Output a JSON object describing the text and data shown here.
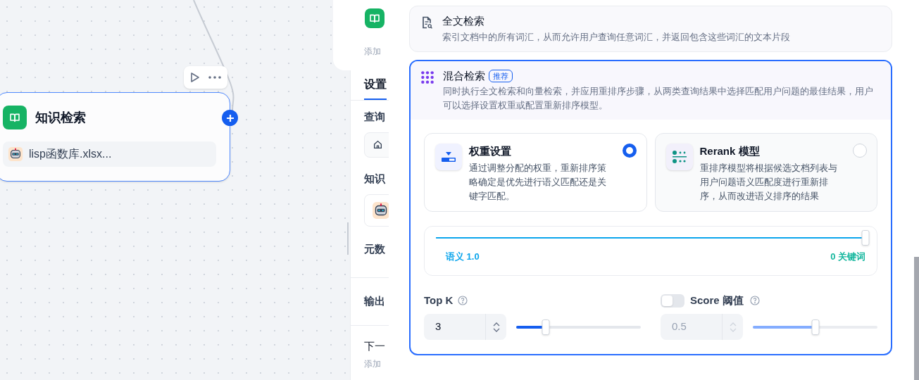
{
  "canvas": {
    "node": {
      "title": "知识检索",
      "items": [
        {
          "label": "lisp函数库.xlsx..."
        }
      ]
    }
  },
  "middle_panel": {
    "hint": "添加",
    "tabs": [
      {
        "label": "设置",
        "selected": true
      }
    ],
    "sections": [
      {
        "label": "查询"
      },
      {
        "label": "知识"
      },
      {
        "label": "元数"
      },
      {
        "label": "输出"
      },
      {
        "label": "下一",
        "hint": "添加"
      }
    ]
  },
  "retrieval_modes": [
    {
      "kind": "fulltext",
      "title": "全文检索",
      "description": "索引文档中的所有词汇，从而允许用户查询任意词汇，并返回包含这些词汇的文本片段",
      "selected": false
    },
    {
      "kind": "hybrid",
      "title": "混合检索",
      "badge": "推荐",
      "description": "同时执行全文检索和向量检索，并应用重排序步骤，从两类查询结果中选择匹配用户问题的最佳结果，用户可以选择设置权重或配置重新排序模型。",
      "selected": true
    }
  ],
  "rerank_options": [
    {
      "kind": "weight",
      "title": "权重设置",
      "description": "通过调整分配的权重，重新排序策略确定是优先进行语义匹配还是关键字匹配。",
      "selected": true
    },
    {
      "kind": "rerank",
      "title": "Rerank 模型",
      "description": "重排序模型将根据候选文档列表与用户问题语义匹配度进行重新排序，从而改进语义排序的结果",
      "selected": false
    }
  ],
  "weight": {
    "level": 1,
    "left_label": "语义 1.0",
    "right_label": "0 关键词"
  },
  "top_k": {
    "label": "Top K",
    "value": "3",
    "level": 0.235
  },
  "score_threshold": {
    "label": "Score 阈值",
    "on": false,
    "value": "0.5",
    "level": 0.5
  }
}
